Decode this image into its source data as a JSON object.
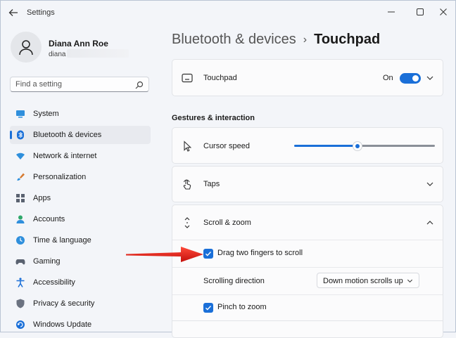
{
  "window": {
    "title": "Settings"
  },
  "profile": {
    "name": "Diana Ann Roe",
    "email_prefix": "diana"
  },
  "search": {
    "placeholder": "Find a setting"
  },
  "nav": {
    "items": [
      {
        "label": "System",
        "active": false
      },
      {
        "label": "Bluetooth & devices",
        "active": true
      },
      {
        "label": "Network & internet",
        "active": false
      },
      {
        "label": "Personalization",
        "active": false
      },
      {
        "label": "Apps",
        "active": false
      },
      {
        "label": "Accounts",
        "active": false
      },
      {
        "label": "Time & language",
        "active": false
      },
      {
        "label": "Gaming",
        "active": false
      },
      {
        "label": "Accessibility",
        "active": false
      },
      {
        "label": "Privacy & security",
        "active": false
      },
      {
        "label": "Windows Update",
        "active": false
      }
    ]
  },
  "breadcrumb": {
    "parent": "Bluetooth & devices",
    "separator": "›",
    "current": "Touchpad"
  },
  "touchpad": {
    "label": "Touchpad",
    "state_label": "On",
    "enabled": true
  },
  "gestures": {
    "section_title": "Gestures & interaction",
    "cursor_speed": {
      "label": "Cursor speed",
      "value_fraction": 0.45
    },
    "taps": {
      "label": "Taps"
    },
    "scroll_zoom": {
      "label": "Scroll & zoom",
      "expanded": true,
      "drag_two_fingers": {
        "label": "Drag two fingers to scroll",
        "checked": true
      },
      "scrolling_direction": {
        "label": "Scrolling direction",
        "value": "Down motion scrolls up"
      },
      "pinch_to_zoom": {
        "label": "Pinch to zoom",
        "checked": true
      }
    }
  },
  "colors": {
    "accent": "#1a6fd8",
    "annotation_arrow": "#e8201c"
  }
}
